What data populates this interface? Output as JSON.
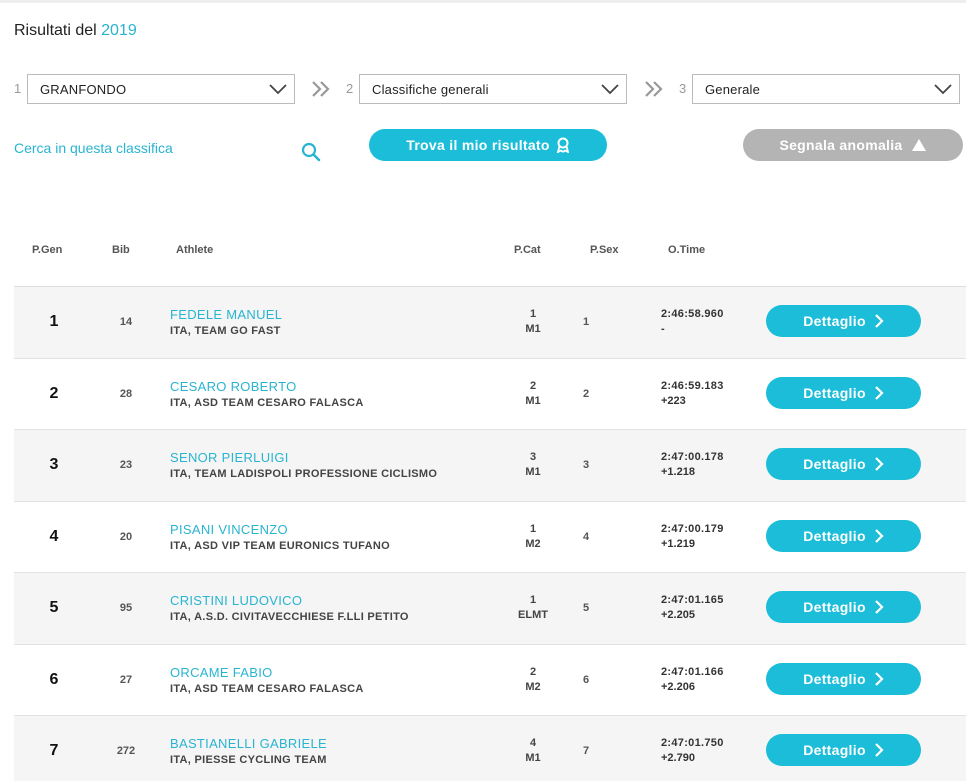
{
  "page": {
    "title_prefix": "Risultati del",
    "title_year": "2019"
  },
  "filters": [
    {
      "step": "1",
      "value": "GRANFONDO"
    },
    {
      "step": "2",
      "value": "Classifiche generali"
    },
    {
      "step": "3",
      "value": "Generale"
    }
  ],
  "search": {
    "label": "Cerca in questa classifica"
  },
  "actions": {
    "find_label": "Trova il mio risultato",
    "report_label": "Segnala anomalia"
  },
  "columns": {
    "pgen": "P.Gen",
    "bib": "Bib",
    "athlete": "Athlete",
    "pcat": "P.Cat",
    "psex": "P.Sex",
    "otime": "O.Time"
  },
  "rows": [
    {
      "pos": "1",
      "bib": "14",
      "name": "FEDELE MANUEL",
      "team": "ITA, TEAM GO FAST",
      "pcat": "1",
      "cat": "M1",
      "psex": "1",
      "time": "2:46:58.960",
      "gap": "-",
      "button": "Dettaglio"
    },
    {
      "pos": "2",
      "bib": "28",
      "name": "CESARO ROBERTO",
      "team": "ITA, ASD TEAM CESARO FALASCA",
      "pcat": "2",
      "cat": "M1",
      "psex": "2",
      "time": "2:46:59.183",
      "gap": "+223",
      "button": "Dettaglio"
    },
    {
      "pos": "3",
      "bib": "23",
      "name": "SENOR PIERLUIGI",
      "team": "ITA, TEAM LADISPOLI PROFESSIONE CICLISMO",
      "pcat": "3",
      "cat": "M1",
      "psex": "3",
      "time": "2:47:00.178",
      "gap": "+1.218",
      "button": "Dettaglio"
    },
    {
      "pos": "4",
      "bib": "20",
      "name": "PISANI VINCENZO",
      "team": "ITA, ASD VIP TEAM EURONICS TUFANO",
      "pcat": "1",
      "cat": "M2",
      "psex": "4",
      "time": "2:47:00.179",
      "gap": "+1.219",
      "button": "Dettaglio"
    },
    {
      "pos": "5",
      "bib": "95",
      "name": "CRISTINI LUDOVICO",
      "team": "ITA, A.S.D. CIVITAVECCHIESE F.LLI PETITO",
      "pcat": "1",
      "cat": "ELMT",
      "psex": "5",
      "time": "2:47:01.165",
      "gap": "+2.205",
      "button": "Dettaglio"
    },
    {
      "pos": "6",
      "bib": "27",
      "name": "ORCAME FABIO",
      "team": "ITA, ASD TEAM CESARO FALASCA",
      "pcat": "2",
      "cat": "M2",
      "psex": "6",
      "time": "2:47:01.166",
      "gap": "+2.206",
      "button": "Dettaglio"
    },
    {
      "pos": "7",
      "bib": "272",
      "name": "BASTIANELLI GABRIELE",
      "team": "ITA, PIESSE CYCLING TEAM",
      "pcat": "4",
      "cat": "M1",
      "psex": "7",
      "time": "2:47:01.750",
      "gap": "+2.790",
      "button": "Dettaglio"
    }
  ],
  "colors": {
    "accent": "#1bbdd8",
    "link": "#29b4d1",
    "disabled": "#b4b4b4"
  },
  "icons": {
    "dropdown": "chevron-down-icon",
    "step_separator": "double-chevron-right-icon",
    "search": "search-icon",
    "find": "medal-icon",
    "report": "warning-triangle-icon",
    "detail": "chevron-right-icon"
  }
}
